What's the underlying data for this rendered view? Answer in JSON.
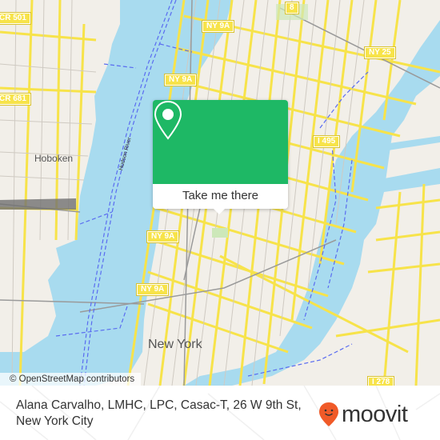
{
  "map": {
    "road_shields": [
      {
        "id": "cr501",
        "label": "CR 501"
      },
      {
        "id": "cr681",
        "label": "CR 681"
      },
      {
        "id": "ny9a_1",
        "label": "NY 9A"
      },
      {
        "id": "ny9a_2",
        "label": "NY 9A"
      },
      {
        "id": "ny9a_3",
        "label": "NY 9A"
      },
      {
        "id": "ny9a_4",
        "label": "NY 9A"
      },
      {
        "id": "rt8",
        "label": "8"
      },
      {
        "id": "ny25",
        "label": "NY 25"
      },
      {
        "id": "i495",
        "label": "I 495"
      },
      {
        "id": "i278",
        "label": "I 278"
      }
    ],
    "places": {
      "hoboken": "Hoboken",
      "new_york": "New York"
    },
    "river_label": "Hudson River",
    "attribution": "© OpenStreetMap contributors",
    "colors": {
      "water": "#a8dbef",
      "land": "#f2efe9",
      "road": "#f7e34a",
      "ferry": "#5a6cf0",
      "rail": "#9a9a9a"
    }
  },
  "popup": {
    "icon": "map-pin-icon",
    "button_label": "Take me there",
    "color": "#1eb865"
  },
  "footer": {
    "address": "Alana Carvalho, LMHC, LPC, Casac-T, 26 W 9th St, New York City",
    "brand": "moovit",
    "brand_color": "#f05a28"
  }
}
